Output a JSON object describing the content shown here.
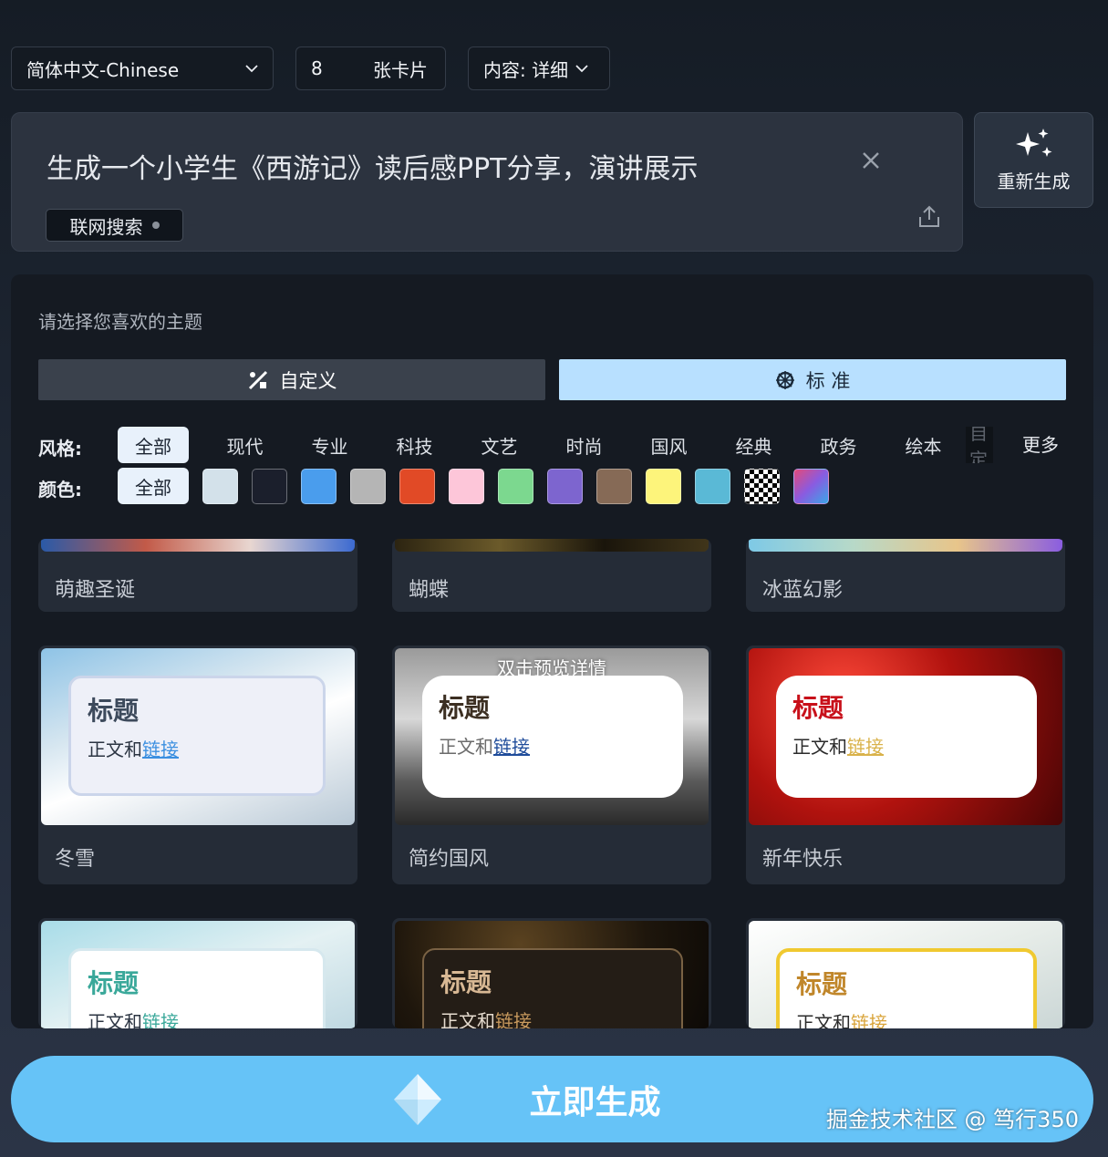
{
  "top": {
    "language": "简体中文-Chinese",
    "card_count": "8",
    "card_unit": "张卡片",
    "detail": "内容: 详细"
  },
  "prompt": {
    "text": "生成一个小学生《西游记》读后感PPT分享，演讲展示",
    "web_search": "联网搜索"
  },
  "regen": {
    "label": "重新生成"
  },
  "panel": {
    "title": "请选择您喜欢的主题",
    "custom_label": "自定义",
    "standard_label": "标 准",
    "style_label": "风格:",
    "color_label": "颜色:",
    "styles": [
      "全部",
      "现代",
      "专业",
      "科技",
      "文艺",
      "时尚",
      "国风",
      "经典",
      "政务",
      "绘本",
      "自定"
    ],
    "more": "更多",
    "color_all": "全部",
    "colors": [
      "#d3e1ea",
      "#1b1f2c",
      "#4a9ded",
      "#b5b5b5",
      "#e14a26",
      "#fdc6d9",
      "#7cd88f",
      "#7d65cf",
      "#866a56",
      "#fdf47b",
      "#5ab9d6",
      "checker",
      "gradient"
    ]
  },
  "cards": [
    {
      "name": "萌趣圣诞"
    },
    {
      "name": "蝴蝶"
    },
    {
      "name": "冰蓝幻影"
    },
    {
      "name": "冬雪",
      "title": "标题",
      "body": "正文和",
      "link": "链接"
    },
    {
      "name": "简约国风",
      "title": "标题",
      "body": "正文和",
      "link": "链接",
      "tip": "双击预览详情"
    },
    {
      "name": "新年快乐",
      "title": "标题",
      "body": "正文和",
      "link": "链接"
    },
    {
      "title": "标题",
      "body": "正文和",
      "link": "链接"
    },
    {
      "title": "标题",
      "body": "正文和",
      "link": "链接"
    },
    {
      "title": "标题",
      "body": "正文和",
      "link": "链接"
    }
  ],
  "generate": {
    "label": "立即生成"
  },
  "watermark": "掘金技术社区 @ 笃行350"
}
